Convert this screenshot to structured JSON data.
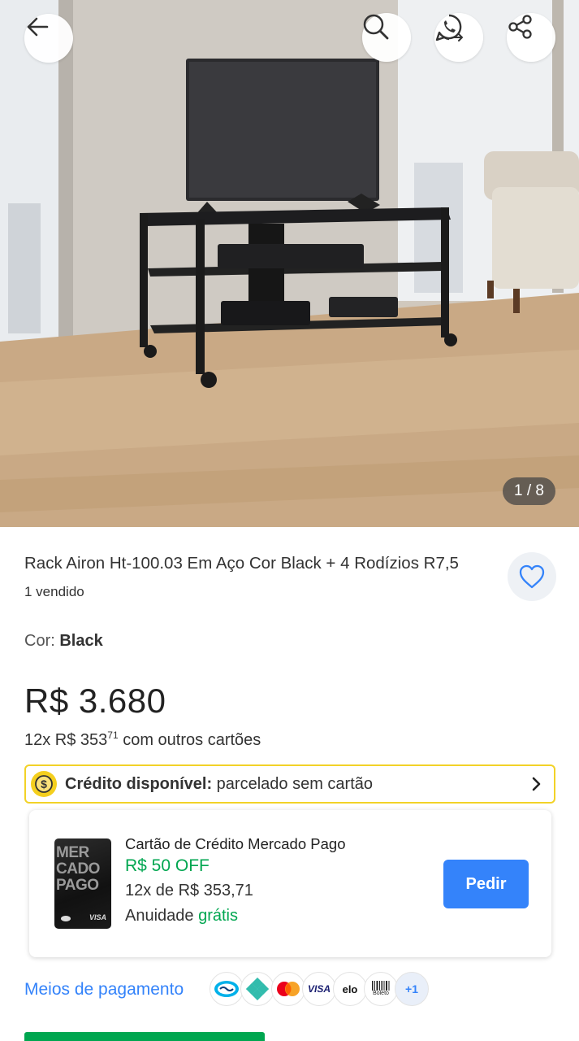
{
  "gallery": {
    "counter": "1 / 8"
  },
  "header_actions": {
    "back_icon": "arrow-left-icon",
    "search_icon": "search-icon",
    "whatsapp_icon": "whatsapp-icon",
    "share_icon": "share-icon"
  },
  "product": {
    "title": "Rack Airon Ht-100.03 Em Aço Cor Black + 4 Rodízios R7,5",
    "sold": "1 vendido",
    "color_label": "Cor: ",
    "color_value": "Black",
    "price": "R$ 3.680",
    "installments_prefix": "12x R$ 353",
    "installments_cents": "71",
    "installments_suffix": " com outros cartões"
  },
  "credit": {
    "bold": "Crédito disponível:",
    "text": " parcelado sem cartão",
    "icon": "coin-dollar-icon"
  },
  "card_offer": {
    "title": "Cartão de Crédito Mercado Pago",
    "discount": "R$ 50 OFF",
    "installments": "12x de R$ 353,71",
    "annuity_prefix": "Anuidade ",
    "annuity_value": "grátis",
    "card_text_lines": [
      "MER",
      "CADO",
      "PAGO"
    ],
    "card_brand": "VISA",
    "button": "Pedir"
  },
  "payment": {
    "label": "Meios de pagamento",
    "methods": [
      "mercado-pago-icon",
      "pix-icon",
      "mastercard-icon",
      "visa-icon",
      "elo-icon",
      "boleto-icon"
    ],
    "visa_text": "VISA",
    "elo_text": "elo",
    "boleto_text": "Boleto",
    "more": "+1"
  },
  "colors": {
    "accent_blue": "#3483fa",
    "green": "#00a650",
    "credit_yellow": "#f2d227"
  }
}
